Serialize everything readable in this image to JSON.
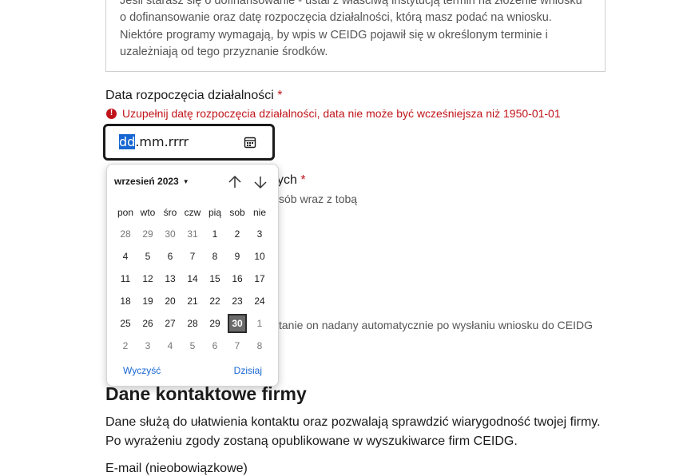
{
  "info": {
    "text": "Jeśli starasz się o dofinansowanie - ustal z właściwą instytucją termin na złożenie wniosku o dofinansowanie oraz datę rozpoczęcia działalności, którą masz podać na wniosku. Niektóre programy wymagają, by wpis w CEIDG pojawił się w określonym terminie i uzależniają od tego przyznanie środków."
  },
  "start_date": {
    "label": "Data rozpoczęcia działalności",
    "required_mark": "*",
    "error": "Uzupełnij datę rozpoczęcia działalności, data nie może być wcześniejsza niż 1950-01-01",
    "seg_day": "dd",
    "seg_rest": ".mm.rrrr"
  },
  "background": {
    "partial_label": "ych",
    "partial_req": "*",
    "partial_hint": "sób wraz z tobą",
    "partial_note": "tanie on nadany automatycznie po wysłaniu wniosku do CEIDG"
  },
  "calendar": {
    "month_label": "wrzesień 2023",
    "weekdays": [
      "pon",
      "wto",
      "śro",
      "czw",
      "pią",
      "sob",
      "nie"
    ],
    "days": [
      "28",
      "29",
      "30",
      "31",
      "1",
      "2",
      "3",
      "4",
      "5",
      "6",
      "7",
      "8",
      "9",
      "10",
      "11",
      "12",
      "13",
      "14",
      "15",
      "16",
      "17",
      "18",
      "19",
      "20",
      "21",
      "22",
      "23",
      "24",
      "25",
      "26",
      "27",
      "28",
      "29",
      "30",
      "1",
      "2",
      "3",
      "4",
      "5",
      "6",
      "7",
      "8"
    ],
    "clear_label": "Wyczyść",
    "today_label": "Dzisiaj"
  },
  "contact": {
    "title": "Dane kontaktowe firmy",
    "desc_line1": "Dane służą do ułatwienia kontaktu oraz pozwalają sprawdzić wiarygodność twojej firmy.",
    "desc_line2": "Po wyrażeniu zgody zostaną opublikowane w wyszukiwarce firm CEIDG."
  },
  "email": {
    "label": "E-mail (nieobowiązkowe)"
  },
  "colors": {
    "error": "#c0141a",
    "link": "#1766d1",
    "today_bg": "#6a6a6a"
  }
}
